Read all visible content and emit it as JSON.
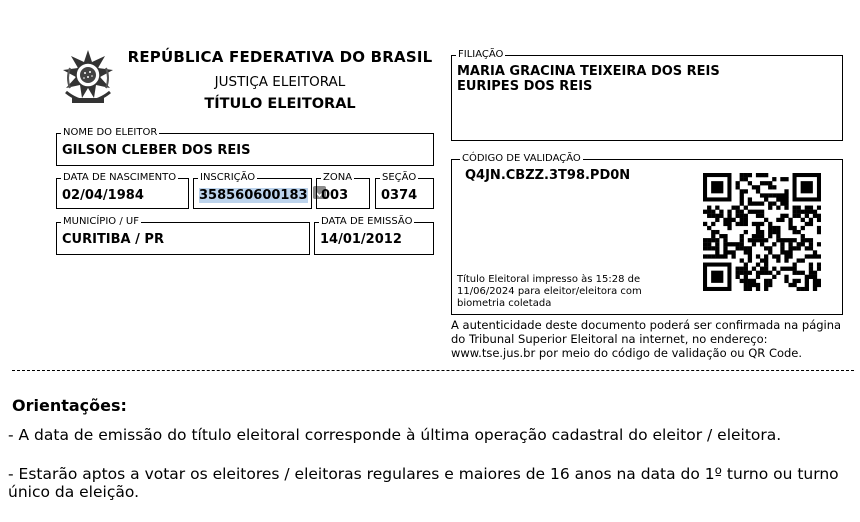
{
  "header": {
    "country": "REPÚBLICA FEDERATIVA DO BRASIL",
    "agency": "JUSTIÇA ELEITORAL",
    "document_title": "TÍTULO ELEITORAL"
  },
  "emblem_icon": "brasao-republica-icon",
  "fields": {
    "elector_name_label": "NOME DO ELEITOR",
    "elector_name": "GILSON CLEBER DOS REIS",
    "birth_date_label": "DATA DE NASCIMENTO",
    "birth_date": "02/04/1984",
    "registration_label": "INSCRIÇÃO",
    "registration": "358560600183",
    "zone_label": "ZONA",
    "zone": "003",
    "section_label": "SEÇÃO",
    "section": "0374",
    "city_label": "MUNICÍPIO / UF",
    "city": "CURITIBA / PR",
    "issue_date_label": "DATA DE EMISSÃO",
    "issue_date": "14/01/2012"
  },
  "filiation": {
    "label": "FILIAÇÃO",
    "mother": "MARIA GRACINA TEIXEIRA DOS REIS",
    "father": "EURIPES DOS REIS"
  },
  "validation": {
    "label": "CÓDIGO DE VALIDAÇÃO",
    "code": "Q4JN.CBZZ.3T98.PD0N",
    "printed_note": "Título Eleitoral impresso às 15:28 de 11/06/2024 para eleitor/eleitora com biometria coletada",
    "qr_icon": "qr-code-icon"
  },
  "authenticity_note": "A autenticidade deste documento poderá ser confirmada na página do Tribunal Superior Eleitoral na internet, no endereço: www.tse.jus.br por meio do código de validação ou QR Code.",
  "guidelines": {
    "title": "Orientações:",
    "item1": "- A data de emissão do título eleitoral corresponde à última operação cadastral do eleitor / eleitora.",
    "item2": "- Estarão aptos a votar os eleitores / eleitoras regulares e maiores de 16 anos na data do 1º turno ou turno único da eleição."
  }
}
